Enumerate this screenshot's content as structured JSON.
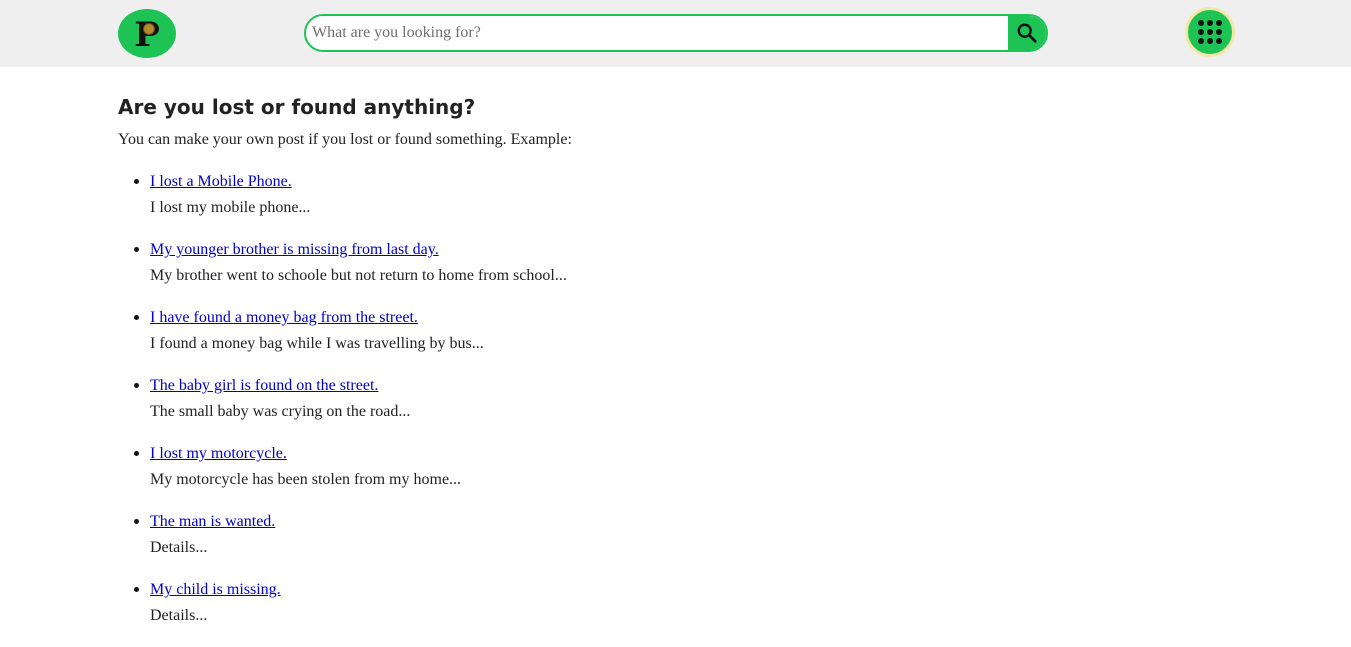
{
  "header": {
    "logo_letter": "P",
    "search": {
      "placeholder": "What are you looking for?",
      "value": ""
    },
    "search_icon": "search-icon",
    "apps_icon": "apps-grid-icon"
  },
  "main": {
    "heading": "Are you lost or found anything?",
    "intro": "You can make your own post if you lost or found something. Example:",
    "posts": [
      {
        "title": "I lost a Mobile Phone.",
        "desc": "I lost my mobile phone..."
      },
      {
        "title": "My younger brother is missing from last day.",
        "desc": "My brother went to schoole but not return to home from school..."
      },
      {
        "title": "I have found a money bag from the street.",
        "desc": "I found a money bag while I was travelling by bus..."
      },
      {
        "title": "The baby girl is found on the street.",
        "desc": "The small baby was crying on the road..."
      },
      {
        "title": "I lost my motorcycle.",
        "desc": "My motorcycle has been stolen from my home..."
      },
      {
        "title": "The man is wanted.",
        "desc": "Details..."
      },
      {
        "title": "My child is missing.",
        "desc": "Details..."
      }
    ]
  },
  "colors": {
    "accent": "#1ec355",
    "link": "#0000cc",
    "header_bg": "#efefef"
  }
}
